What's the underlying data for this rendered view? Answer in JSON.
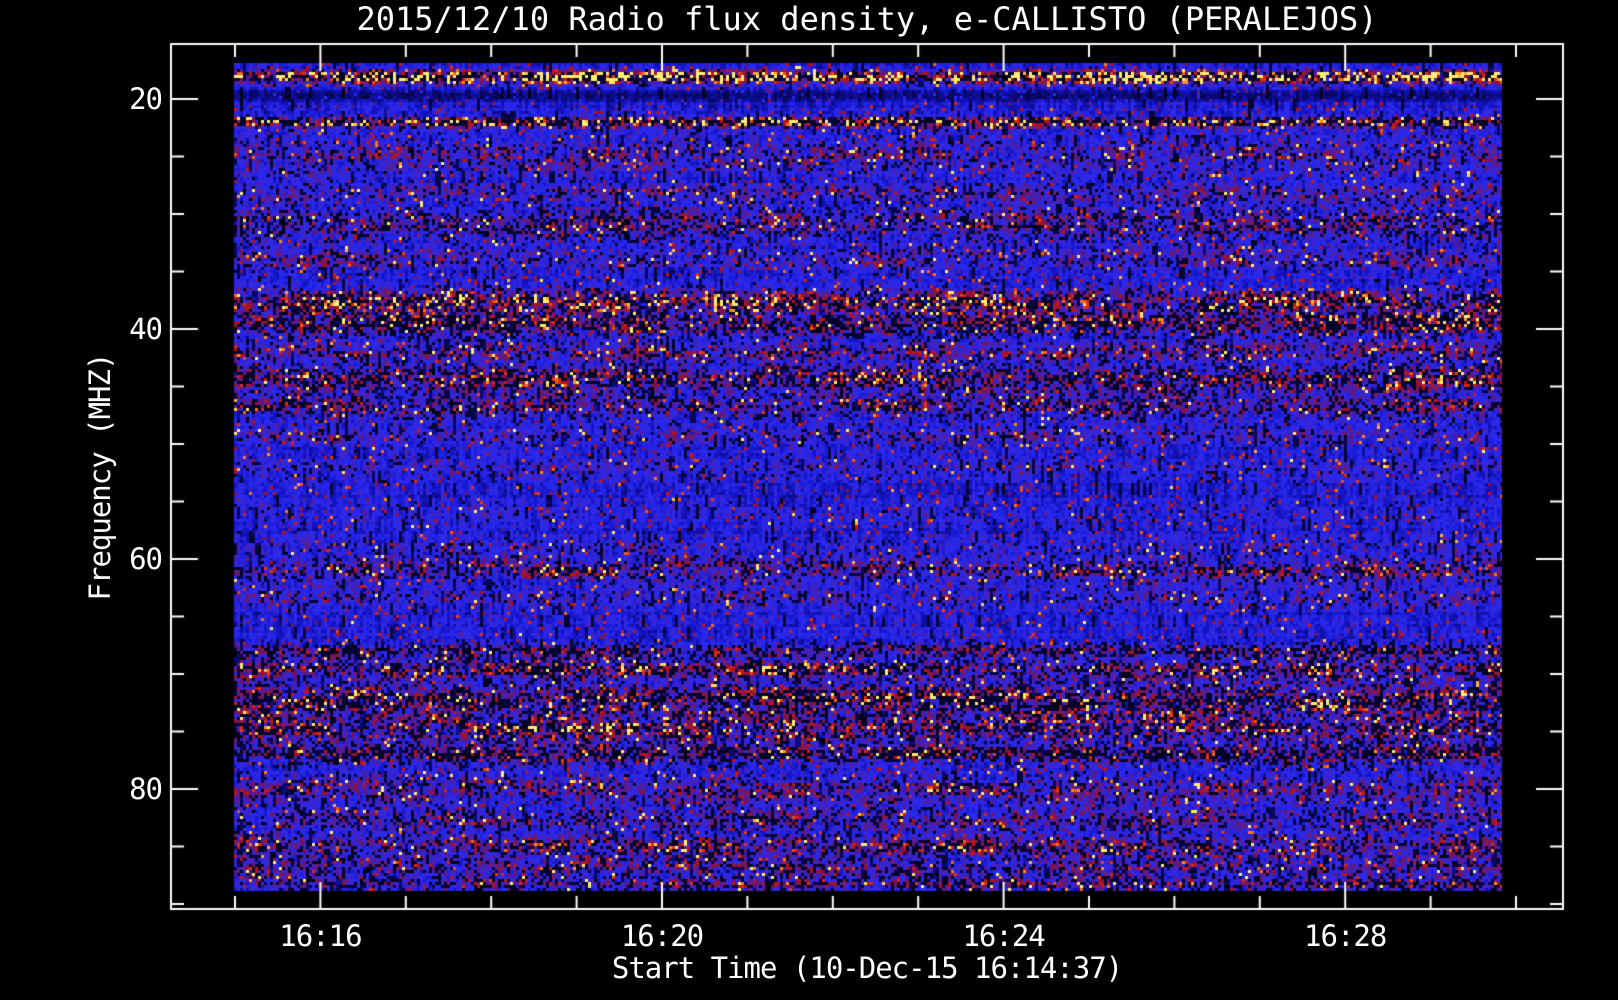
{
  "window": {
    "background": "#000000",
    "text_color": "#ffffff"
  },
  "chart": {
    "title": "2015/12/10  Radio flux density, e-CALLISTO (PERALEJOS)",
    "xlabel": "Start Time (10-Dec-15 16:14:37)",
    "ylabel": "Frequency (MHZ)"
  },
  "chart_data": {
    "type": "heatmap",
    "subtype": "radio-spectrogram",
    "title": "2015/12/10  Radio flux density, e-CALLISTO (PERALEJOS)",
    "xlabel": "Start Time (10-Dec-15 16:14:37)",
    "ylabel": "Frequency (MHZ)",
    "grid": false,
    "legend": "none",
    "x_axis": {
      "major_tick_labels": [
        "16:16",
        "16:20",
        "16:24",
        "16:28"
      ],
      "major_tick_minutes_after_16_15": [
        1,
        5,
        9,
        13
      ],
      "minor_tick_every_minutes": 1,
      "minor_tick_minute_range": [
        0,
        15
      ],
      "start_time_annotation": "10-Dec-15 16:14:37"
    },
    "y_axis": {
      "major_tick_labels": [
        "20",
        "40",
        "60",
        "80"
      ],
      "major_tick_values_mhz": [
        20,
        40,
        60,
        80
      ],
      "minor_tick_every_mhz": 5,
      "minor_tick_range_mhz": [
        25,
        90
      ],
      "axis_range_mhz": [
        15.2,
        90.4
      ],
      "data_range_mhz": [
        16.9,
        88.9
      ],
      "direction": "increasing-downward"
    },
    "colormap_stops": [
      [
        0.0,
        "#000000"
      ],
      [
        0.1,
        "#050532"
      ],
      [
        0.2,
        "#0a0a78"
      ],
      [
        0.32,
        "#1414c8"
      ],
      [
        0.44,
        "#2a2af0"
      ],
      [
        0.52,
        "#3525d8"
      ],
      [
        0.6,
        "#511d9e"
      ],
      [
        0.68,
        "#6f1560"
      ],
      [
        0.76,
        "#a01428"
      ],
      [
        0.84,
        "#cc1414"
      ],
      [
        0.9,
        "#ee4410"
      ],
      [
        0.95,
        "#ff9020"
      ],
      [
        1.0,
        "#ffee70"
      ]
    ],
    "background_character": "saturated blue noise field with red speckle, purple mottling and dark vertical dropouts",
    "noise_seed": 20151210,
    "rfi_bands": [
      {
        "freq_mhz": 18.1,
        "width_mhz": 0.5,
        "intensity": 1.15,
        "gap_fraction": 0.4,
        "note": "very bright intermittent RFI line (yellow/orange dashes)"
      },
      {
        "freq_mhz": 19.7,
        "width_mhz": 0.5,
        "intensity": -0.5,
        "gap_fraction": 0.0,
        "note": "dark lane below bright line"
      },
      {
        "freq_mhz": 22.0,
        "width_mhz": 0.4,
        "intensity": 0.85,
        "gap_fraction": 0.5,
        "note": "bright dashed RFI line"
      },
      {
        "freq_mhz": 25.0,
        "width_mhz": 1.6,
        "intensity": 0.26,
        "gap_fraction": 0.15
      },
      {
        "freq_mhz": 28.2,
        "width_mhz": 0.9,
        "intensity": 0.22,
        "gap_fraction": 0.15
      },
      {
        "freq_mhz": 31.0,
        "width_mhz": 1.4,
        "intensity": 0.3,
        "gap_fraction": 0.3
      },
      {
        "freq_mhz": 34.0,
        "width_mhz": 1.0,
        "intensity": 0.24,
        "gap_fraction": 0.15
      },
      {
        "freq_mhz": 37.6,
        "width_mhz": 1.0,
        "intensity": 0.55,
        "gap_fraction": 0.35,
        "note": "strong red band"
      },
      {
        "freq_mhz": 39.6,
        "width_mhz": 1.0,
        "intensity": 0.5,
        "gap_fraction": 0.48,
        "note": "red/black band"
      },
      {
        "freq_mhz": 42.0,
        "width_mhz": 0.8,
        "intensity": 0.32,
        "gap_fraction": 0.2
      },
      {
        "freq_mhz": 44.3,
        "width_mhz": 1.1,
        "intensity": 0.42,
        "gap_fraction": 0.38
      },
      {
        "freq_mhz": 46.8,
        "width_mhz": 1.0,
        "intensity": 0.34,
        "gap_fraction": 0.3
      },
      {
        "freq_mhz": 49.4,
        "width_mhz": 0.8,
        "intensity": 0.22,
        "gap_fraction": 0.15
      },
      {
        "freq_mhz": 52.2,
        "width_mhz": 1.0,
        "intensity": 0.14,
        "gap_fraction": 0.1
      },
      {
        "freq_mhz": 56.0,
        "width_mhz": 1.2,
        "intensity": 0.08,
        "gap_fraction": 0.05
      },
      {
        "freq_mhz": 59.0,
        "width_mhz": 0.8,
        "intensity": 0.18,
        "gap_fraction": 0.1
      },
      {
        "freq_mhz": 61.0,
        "width_mhz": 0.9,
        "intensity": 0.36,
        "gap_fraction": 0.28,
        "note": "speckled red band"
      },
      {
        "freq_mhz": 63.4,
        "width_mhz": 0.8,
        "intensity": 0.2,
        "gap_fraction": 0.12
      },
      {
        "freq_mhz": 68.0,
        "width_mhz": 0.6,
        "intensity": 0.34,
        "gap_fraction": 0.45
      },
      {
        "freq_mhz": 69.6,
        "width_mhz": 0.7,
        "intensity": 0.5,
        "gap_fraction": 0.4,
        "note": "strong red dashes"
      },
      {
        "freq_mhz": 72.3,
        "width_mhz": 1.4,
        "intensity": 0.48,
        "gap_fraction": 0.42,
        "note": "heavy mixed red/black band"
      },
      {
        "freq_mhz": 74.8,
        "width_mhz": 1.0,
        "intensity": 0.46,
        "gap_fraction": 0.33
      },
      {
        "freq_mhz": 77.0,
        "width_mhz": 0.8,
        "intensity": 0.4,
        "gap_fraction": 0.5
      },
      {
        "freq_mhz": 80.0,
        "width_mhz": 1.2,
        "intensity": 0.3,
        "gap_fraction": 0.2
      },
      {
        "freq_mhz": 82.7,
        "width_mhz": 1.0,
        "intensity": 0.28,
        "gap_fraction": 0.25
      },
      {
        "freq_mhz": 85.0,
        "width_mhz": 0.8,
        "intensity": 0.38,
        "gap_fraction": 0.3
      },
      {
        "freq_mhz": 86.8,
        "width_mhz": 0.9,
        "intensity": 0.3,
        "gap_fraction": 0.25
      },
      {
        "freq_mhz": 88.3,
        "width_mhz": 0.6,
        "intensity": 0.3,
        "gap_fraction": 0.3
      }
    ]
  }
}
